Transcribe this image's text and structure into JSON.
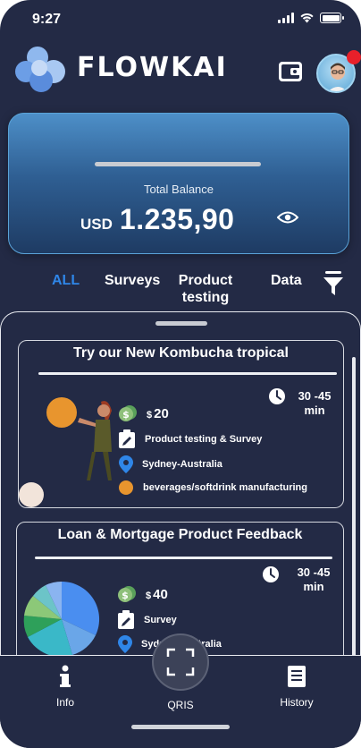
{
  "status_bar": {
    "time": "9:27"
  },
  "header": {
    "brand": "FLOWKAI"
  },
  "balance": {
    "label": "Total Balance",
    "currency": "USD",
    "amount": "1.235,90"
  },
  "tabs": [
    {
      "label": "ALL",
      "active": true
    },
    {
      "label": "Surveys",
      "active": false
    },
    {
      "label": "Product testing",
      "active": false
    },
    {
      "label": "Data",
      "active": false
    }
  ],
  "surveys": [
    {
      "title": "Try our New Kombucha tropical",
      "reward_symbol": "$",
      "reward": "20",
      "duration": "30 -45 min",
      "type": "Product testing & Survey",
      "location": "Sydney-Australia",
      "category": "beverages/softdrink manufacturing"
    },
    {
      "title": "Loan & Mortgage Product Feedback",
      "reward_symbol": "$",
      "reward": "40",
      "duration": "30 -45 min",
      "type": "Survey",
      "location": "Sydney-Australia"
    }
  ],
  "bottom_nav": [
    {
      "label": "Info",
      "icon": "info-icon"
    },
    {
      "label": "QRIS",
      "icon": "scan-icon"
    },
    {
      "label": "History",
      "icon": "history-icon"
    }
  ],
  "colors": {
    "background": "#232a45",
    "accent": "#2f86e8",
    "card_top": "#4d8fc8",
    "card_bottom": "#1e3b63",
    "notification": "#e8202a",
    "orange": "#e8952e"
  }
}
